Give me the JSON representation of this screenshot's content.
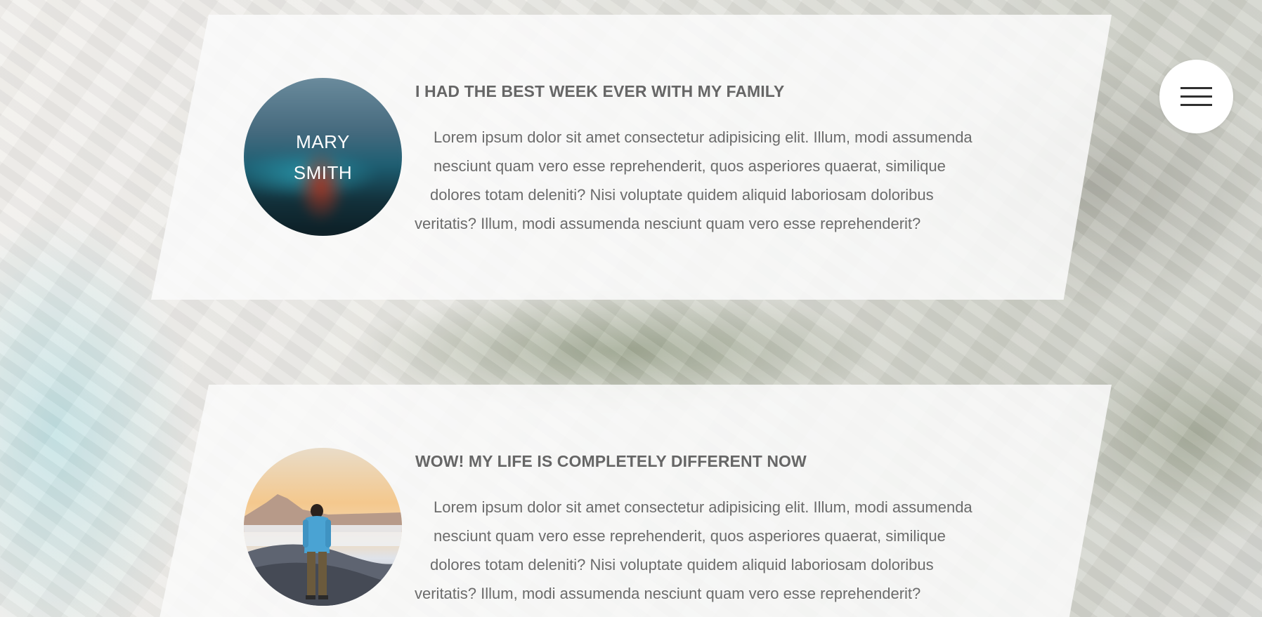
{
  "menu": {
    "icon": "hamburger-menu-icon"
  },
  "testimonials": [
    {
      "avatar_name_line1": "MARY",
      "avatar_name_line2": "SMITH",
      "title": "I HAD THE BEST WEEK EVER WITH MY FAMILY",
      "lines": [
        "Lorem ipsum dolor sit amet consectetur adipisicing elit. Illum, modi assumenda",
        "nesciunt quam vero esse reprehenderit, quos asperiores quaerat, similique",
        "dolores totam deleniti? Nisi voluptate quidem aliquid laboriosam doloribus",
        "veritatis? Illum, modi assumenda nesciunt quam vero esse reprehenderit?"
      ]
    },
    {
      "title": "WOW! MY LIFE IS COMPLETELY DIFFERENT NOW",
      "lines": [
        "Lorem ipsum dolor sit amet consectetur adipisicing elit. Illum, modi assumenda",
        "nesciunt quam vero esse reprehenderit, quos asperiores quaerat, similique",
        "dolores totam deleniti? Nisi voluptate quidem aliquid laboriosam doloribus",
        "veritatis? Illum, modi assumenda nesciunt quam vero esse reprehenderit?"
      ]
    }
  ]
}
